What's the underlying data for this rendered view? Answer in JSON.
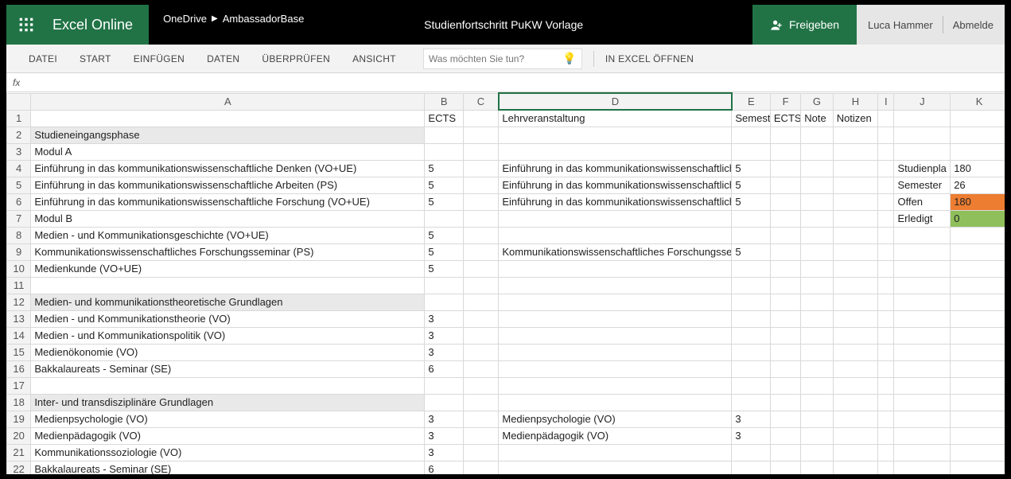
{
  "titlebar": {
    "brand": "Excel Online",
    "breadcrumb_root": "OneDrive",
    "breadcrumb_folder": "AmbassadorBase",
    "doc_title": "Studienfortschritt PuKW Vorlage",
    "share_label": "Freigeben",
    "user_name": "Luca Hammer",
    "signout": "Abmelde"
  },
  "ribbon": {
    "tabs": [
      "DATEI",
      "START",
      "EINFÜGEN",
      "DATEN",
      "ÜBERPRÜFEN",
      "ANSICHT"
    ],
    "tellme_placeholder": "Was möchten Sie tun?",
    "open_in_excel": "IN EXCEL ÖFFNEN"
  },
  "formula_bar": {
    "fx": "fx",
    "value": ""
  },
  "columns": [
    "A",
    "B",
    "C",
    "D",
    "E",
    "F",
    "G",
    "H",
    "I",
    "J",
    "K"
  ],
  "headers_row": {
    "B": "ECTS",
    "D": "Lehrveranstaltung",
    "E": "Semest",
    "F": "ECTS",
    "G": "Note",
    "H": "Notizen"
  },
  "summary": {
    "studienplan_label": "Studienpla",
    "studienplan_value": "180",
    "semester_label": "Semester",
    "semester_value": "26",
    "offen_label": "Offen",
    "offen_value": "180",
    "erledigt_label": "Erledigt",
    "erledigt_value": "0"
  },
  "rows": [
    {
      "n": 2,
      "A": "Studieneingangsphase",
      "bold": true,
      "shade": true
    },
    {
      "n": 3,
      "A": "Modul A",
      "bold": true
    },
    {
      "n": 4,
      "A": "Einführung in das kommunikationswissenschaftliche Denken (VO+UE)",
      "B": "5",
      "D": "Einführung in das kommunikationswissenschaftlich",
      "E": "5",
      "J": "Studienpla",
      "K": "180"
    },
    {
      "n": 5,
      "A": "Einführung in das kommunikationswissenschaftliche Arbeiten (PS)",
      "B": "5",
      "D": "Einführung in das kommunikationswissenschaftlich",
      "E": "5",
      "J": "Semester",
      "K": "26"
    },
    {
      "n": 6,
      "A": "Einführung in das kommunikationswissenschaftliche Forschung (VO+UE)",
      "B": "5",
      "D": "Einführung in das kommunikationswissenschaftlich",
      "E": "5",
      "J": "Offen",
      "K": "180",
      "Kclass": "orange"
    },
    {
      "n": 7,
      "A": "Modul B",
      "bold": true,
      "J": "Erledigt",
      "K": "0",
      "Kclass": "green"
    },
    {
      "n": 8,
      "A": "Medien - und Kommunikationsgeschichte (VO+UE)",
      "B": "5"
    },
    {
      "n": 9,
      "A": "Kommunikationswissenschaftliches Forschungsseminar (PS)",
      "B": "5",
      "D": "Kommunikationswissenschaftliches Forschungsser",
      "E": "5"
    },
    {
      "n": 10,
      "A": "Medienkunde (VO+UE)",
      "B": "5"
    },
    {
      "n": 11
    },
    {
      "n": 12,
      "A": "Medien- und kommunikationstheoretische Grundlagen",
      "bold": true,
      "shade": true
    },
    {
      "n": 13,
      "A": "Medien - und Kommunikationstheorie (VO)",
      "B": "3"
    },
    {
      "n": 14,
      "A": "Medien - und Kommunikationspolitik (VO)",
      "B": "3"
    },
    {
      "n": 15,
      "A": "Medienökonomie (VO)",
      "B": "3"
    },
    {
      "n": 16,
      "A": "Bakkalaureats - Seminar (SE)",
      "B": "6"
    },
    {
      "n": 17
    },
    {
      "n": 18,
      "A": "Inter- und transdisziplinäre Grundlagen",
      "bold": true,
      "shade": true
    },
    {
      "n": 19,
      "A": "Medienpsychologie (VO)",
      "B": "3",
      "D": "Medienpsychologie (VO)",
      "E": "3"
    },
    {
      "n": 20,
      "A": "Medienpädagogik (VO)",
      "B": "3",
      "D": "Medienpädagogik (VO)",
      "E": "3"
    },
    {
      "n": 21,
      "A": "Kommunikationssoziologie (VO)",
      "B": "3"
    },
    {
      "n": 22,
      "A": "Bakkalaureats - Seminar (SE)",
      "B": "6"
    }
  ]
}
